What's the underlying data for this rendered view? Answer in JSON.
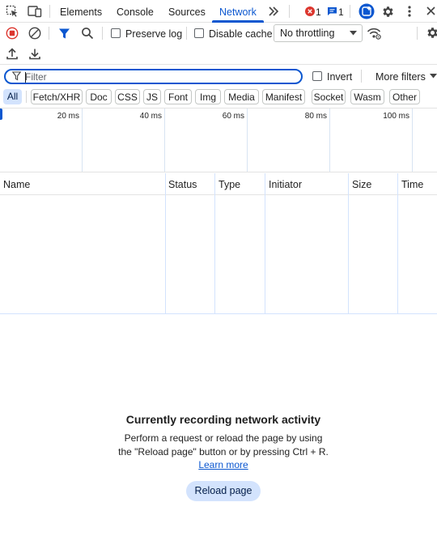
{
  "tabs": [
    {
      "label": "Elements"
    },
    {
      "label": "Console"
    },
    {
      "label": "Sources"
    },
    {
      "label": "Network"
    }
  ],
  "active_tab": "Network",
  "issues": {
    "errors": "1",
    "messages": "1"
  },
  "toolbar": {
    "preserve_log": "Preserve log",
    "disable_cache": "Disable cache",
    "throttling": "No throttling"
  },
  "filter": {
    "placeholder": "Filter",
    "invert": "Invert",
    "more_filters": "More filters"
  },
  "type_filters": [
    "All",
    "Fetch/XHR",
    "Doc",
    "CSS",
    "JS",
    "Font",
    "Img",
    "Media",
    "Manifest",
    "Socket",
    "Wasm",
    "Other"
  ],
  "timeline_ticks": [
    "20 ms",
    "40 ms",
    "60 ms",
    "80 ms",
    "100 ms"
  ],
  "table": {
    "columns": [
      "Name",
      "Status",
      "Type",
      "Initiator",
      "Size",
      "Time"
    ]
  },
  "empty_state": {
    "title": "Currently recording network activity",
    "description": "Perform a request or reload the page by using the \"Reload page\" button or by pressing Ctrl + R.",
    "learn_more": "Learn more",
    "reload_button": "Reload page"
  },
  "colors": {
    "accent": "#0b57d0",
    "record_red": "#dc362e",
    "chip_active_bg": "#d3e3fd"
  },
  "icons": [
    "inspect-element-icon",
    "device-toolbar-icon",
    "more-tabs-icon",
    "error-icon",
    "message-icon",
    "ai-assistant-icon",
    "settings-icon",
    "more-options-icon",
    "close-icon",
    "record-icon",
    "clear-icon",
    "filter-icon",
    "search-icon",
    "chevron-down-icon",
    "network-conditions-icon",
    "import-har-icon",
    "export-har-icon"
  ]
}
